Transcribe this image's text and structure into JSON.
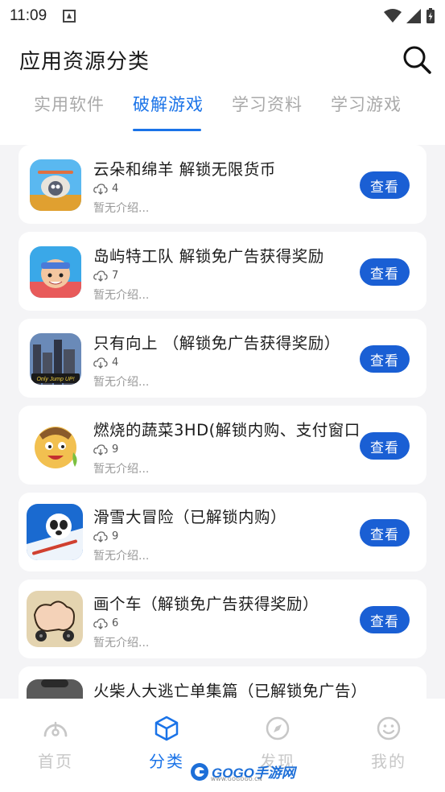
{
  "status_bar": {
    "time": "11:09"
  },
  "header": {
    "title": "应用资源分类",
    "tabs": [
      {
        "label": "实用软件",
        "active": false
      },
      {
        "label": "破解游戏",
        "active": true
      },
      {
        "label": "学习资料",
        "active": false
      },
      {
        "label": "学习游戏",
        "active": false
      }
    ]
  },
  "apps": [
    {
      "title": "云朵和绵羊 解锁无限货币",
      "downloads": "4",
      "desc": "暂无介绍...",
      "button": "查看",
      "icon": "sheep-game-icon"
    },
    {
      "title": "岛屿特工队 解锁免广告获得奖励",
      "downloads": "7",
      "desc": "暂无介绍...",
      "button": "查看",
      "icon": "island-agent-game-icon"
    },
    {
      "title": "只有向上 （解锁免广告获得奖励）",
      "downloads": "4",
      "desc": "暂无介绍...",
      "button": "查看",
      "icon": "only-jump-up-game-icon",
      "icon_text": "Only Jump UP!"
    },
    {
      "title": "燃烧的蔬菜3HD(解锁内购、支付窗口)",
      "downloads": "9",
      "desc": "暂无介绍...",
      "button": "查看",
      "icon": "burning-vegetable-game-icon"
    },
    {
      "title": "滑雪大冒险（已解锁内购）",
      "downloads": "9",
      "desc": "暂无介绍...",
      "button": "查看",
      "icon": "ski-safari-game-icon"
    },
    {
      "title": "画个车（解锁免广告获得奖励）",
      "downloads": "6",
      "desc": "暂无介绍...",
      "button": "查看",
      "icon": "draw-car-game-icon"
    },
    {
      "title": "火柴人大逃亡单集篇（已解锁免广告）",
      "downloads": "",
      "desc": "",
      "button": "",
      "icon": "stickman-game-icon"
    }
  ],
  "bottom_nav": [
    {
      "label": "首页",
      "icon": "home-dashboard-icon",
      "active": false
    },
    {
      "label": "分类",
      "icon": "category-box-icon",
      "active": true
    },
    {
      "label": "发现",
      "icon": "compass-icon",
      "active": false
    },
    {
      "label": "我的",
      "icon": "smiley-profile-icon",
      "active": false
    }
  ],
  "watermark": {
    "text": "GOGO手游网",
    "sub": "WWW.GOGOGO.CN"
  },
  "colors": {
    "accent": "#1a73e8",
    "button": "#1a5fd4",
    "inactive": "#c7c7c7"
  }
}
